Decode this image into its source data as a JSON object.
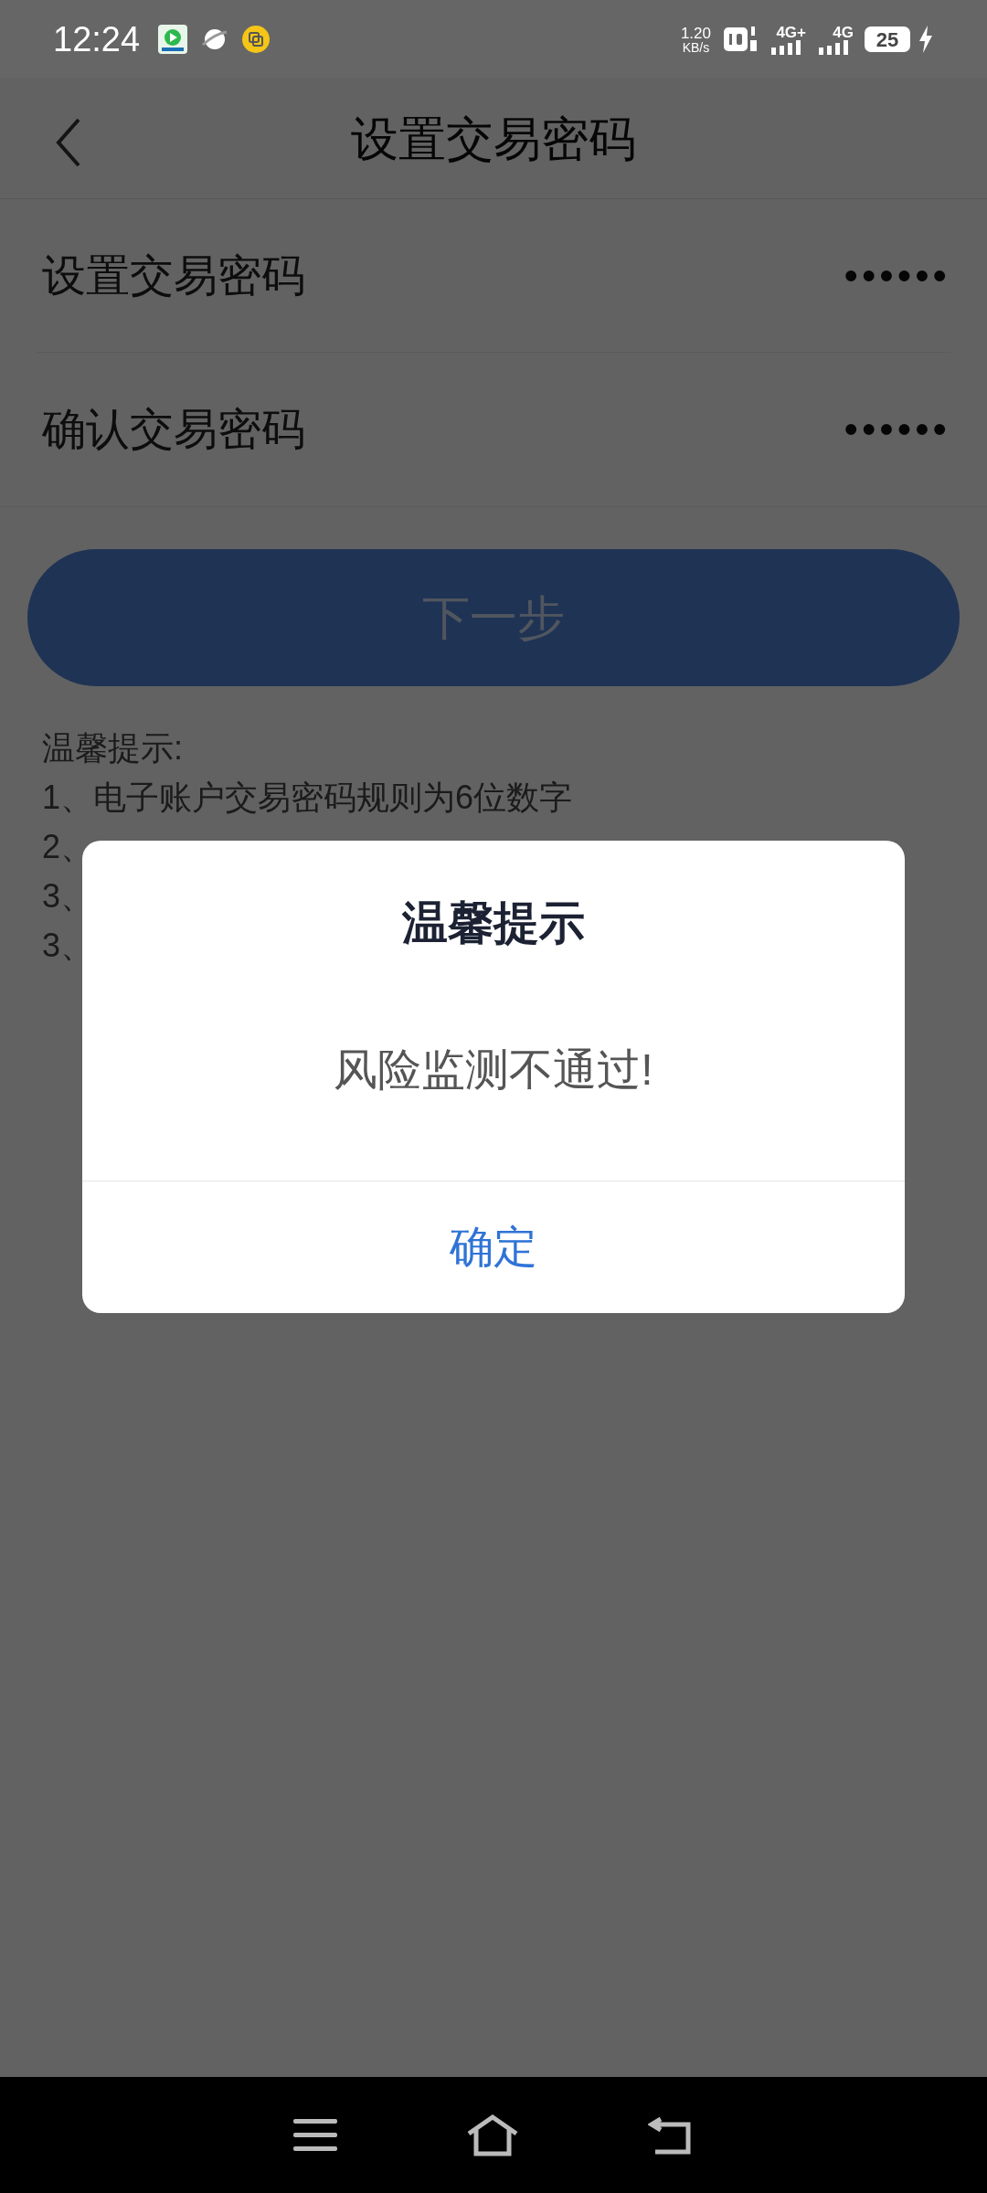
{
  "status_bar": {
    "time": "12:24",
    "net_speed": "1.20",
    "net_unit": "KB/s",
    "sim1": "4G+",
    "sim2": "4G",
    "battery": "25"
  },
  "header": {
    "title": "设置交易密码"
  },
  "fields": [
    {
      "label": "设置交易密码",
      "value": "••••••"
    },
    {
      "label": "确认交易密码",
      "value": "••••••"
    }
  ],
  "next_button": {
    "label": "下一步",
    "disabled": true
  },
  "tips": {
    "title": "温馨提示:",
    "lines": [
      "1、电子账户交易密码规则为6位数字",
      "2、",
      "3、",
      "3、"
    ]
  },
  "dialog": {
    "title": "温馨提示",
    "message": "风险监测不通过!",
    "confirm": "确定"
  }
}
